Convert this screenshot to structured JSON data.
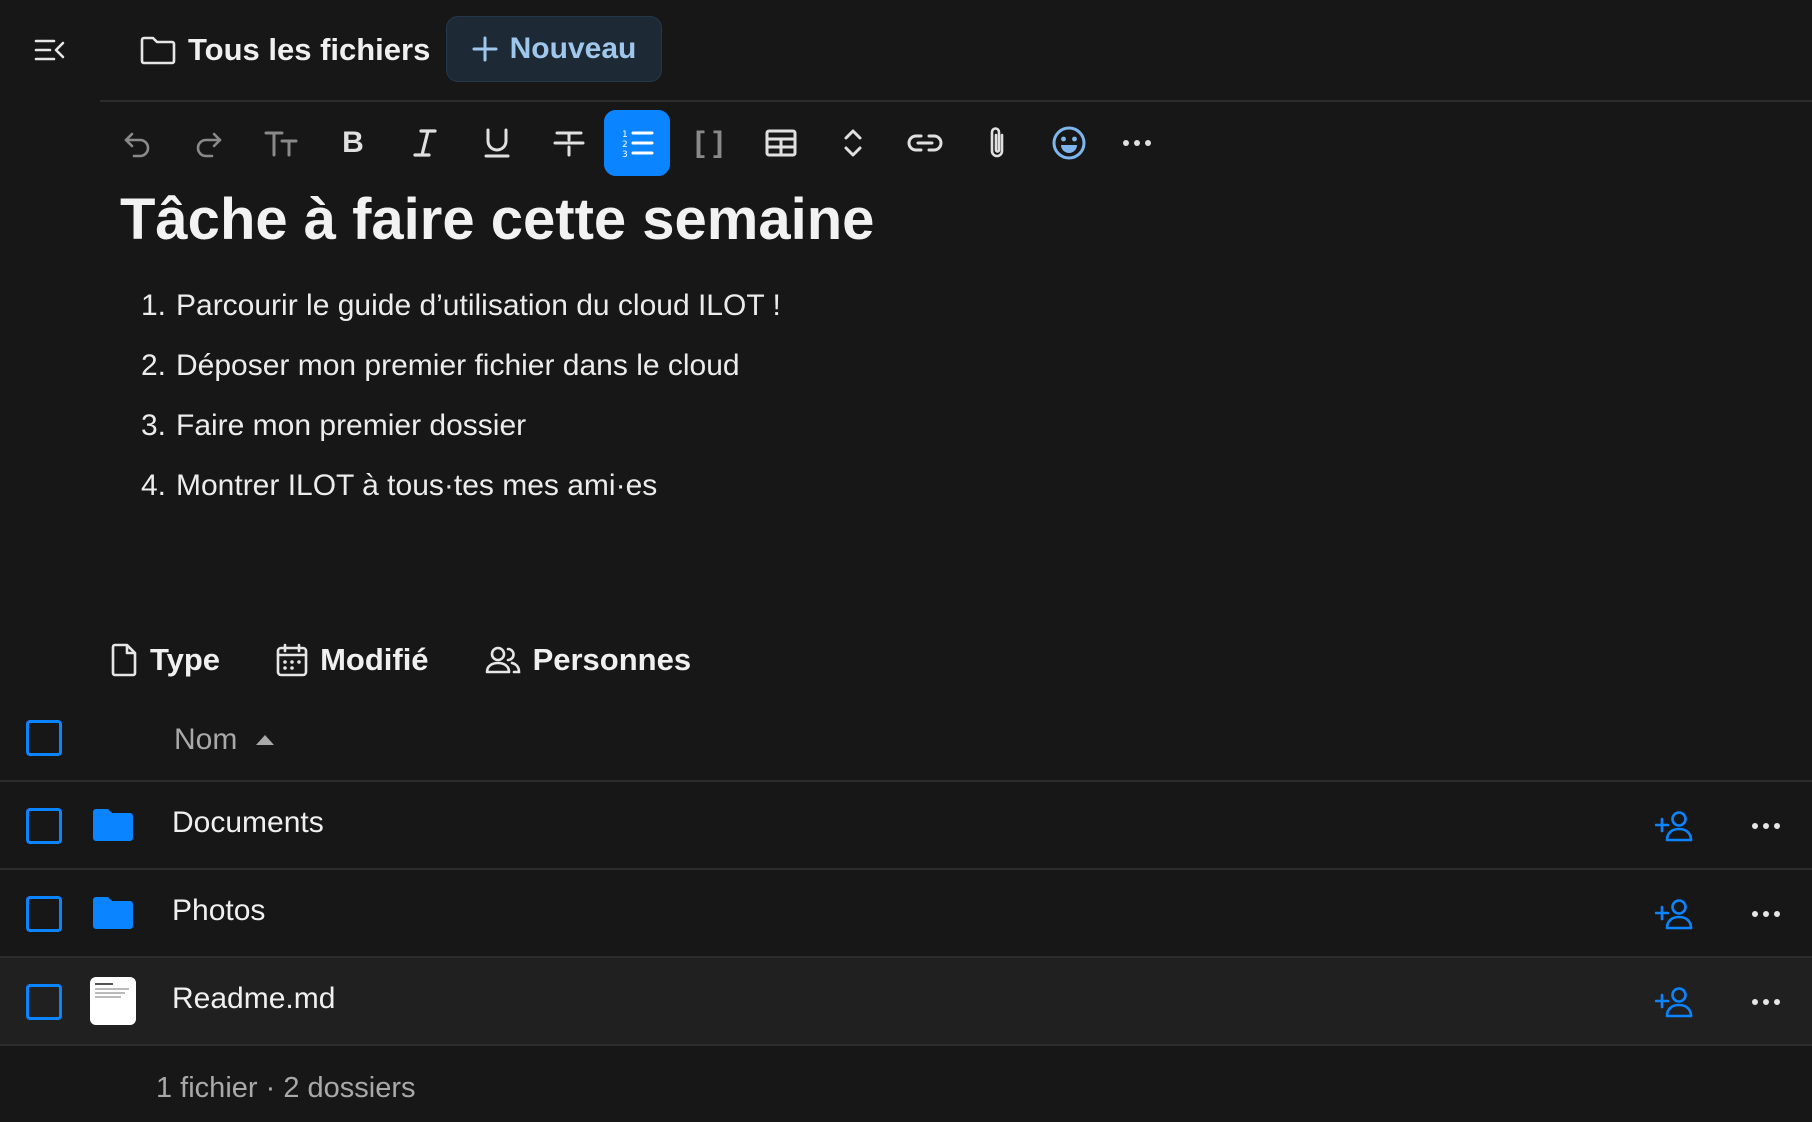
{
  "header": {
    "menu_icon": "sidebar-toggle-icon",
    "breadcrumb_label": "Tous les fichiers",
    "new_button_label": "Nouveau"
  },
  "toolbar": {
    "buttons": [
      {
        "name": "undo",
        "icon": "undo-icon",
        "active": false
      },
      {
        "name": "redo",
        "icon": "redo-icon",
        "active": false
      },
      {
        "name": "headings",
        "icon": "text-size-icon",
        "active": false
      },
      {
        "name": "bold",
        "icon": "bold-icon",
        "active": false
      },
      {
        "name": "italic",
        "icon": "italic-icon",
        "active": false
      },
      {
        "name": "underline",
        "icon": "underline-icon",
        "active": false
      },
      {
        "name": "strikethrough",
        "icon": "strikethrough-icon",
        "active": false
      },
      {
        "name": "ordered-list",
        "icon": "ordered-list-icon",
        "active": true
      },
      {
        "name": "checklist",
        "icon": "brackets-icon",
        "active": false
      },
      {
        "name": "table",
        "icon": "table-icon",
        "active": false
      },
      {
        "name": "collapse",
        "icon": "unfold-icon",
        "active": false
      },
      {
        "name": "link",
        "icon": "link-icon",
        "active": false
      },
      {
        "name": "attachment",
        "icon": "paperclip-icon",
        "active": false
      },
      {
        "name": "emoji",
        "icon": "emoji-icon",
        "active": false
      },
      {
        "name": "more",
        "icon": "more-icon",
        "active": false
      }
    ]
  },
  "document": {
    "title": "Tâche à faire cette semaine",
    "items": [
      {
        "num": "1.",
        "text": "Parcourir le guide d’utilisation du cloud ILOT !"
      },
      {
        "num": "2.",
        "text": "Déposer mon premier fichier dans le cloud"
      },
      {
        "num": "3.",
        "text": "Faire mon premier dossier"
      },
      {
        "num": "4.",
        "text": "Montrer ILOT à tous·tes mes ami·es"
      }
    ]
  },
  "filters": {
    "type_label": "Type",
    "modified_label": "Modifié",
    "people_label": "Personnes"
  },
  "table": {
    "name_header": "Nom",
    "rows": [
      {
        "name": "Documents",
        "kind": "folder"
      },
      {
        "name": "Photos",
        "kind": "folder"
      },
      {
        "name": "Readme.md",
        "kind": "file"
      }
    ],
    "summary": "1 fichier · 2 dossiers"
  },
  "colors": {
    "accent": "#0a84ff",
    "background": "#171717",
    "new_button_bg": "#1d2a36"
  }
}
